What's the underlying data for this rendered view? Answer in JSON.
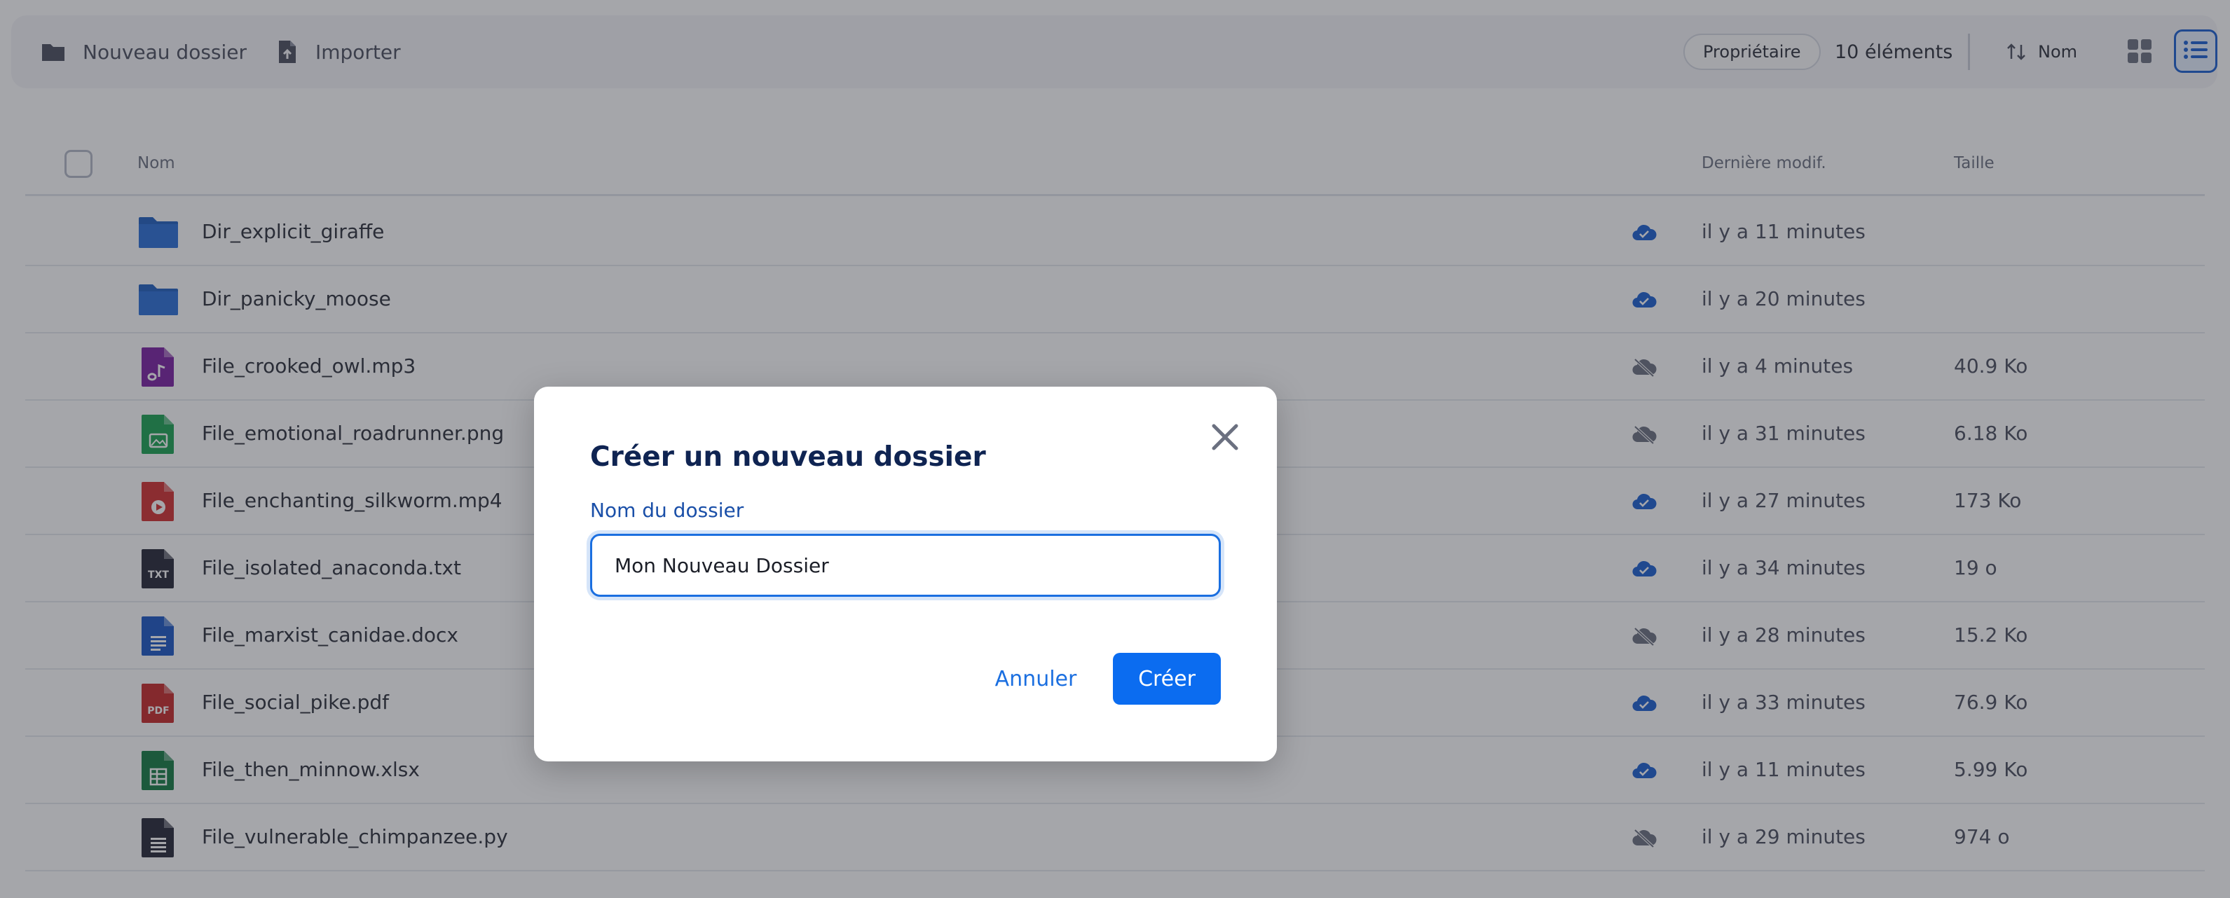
{
  "toolbar": {
    "new_folder_label": "Nouveau dossier",
    "import_label": "Importer",
    "owner_filter_label": "Propriétaire",
    "item_count": "10 éléments",
    "sort_label": "Nom"
  },
  "table": {
    "headers": {
      "name": "Nom",
      "modified": "Dernière modif.",
      "size": "Taille"
    },
    "rows": [
      {
        "name": "Dir_explicit_giraffe",
        "type": "folder",
        "synced": true,
        "modified": "il y a 11 minutes",
        "size": ""
      },
      {
        "name": "Dir_panicky_moose",
        "type": "folder",
        "synced": true,
        "modified": "il y a 20 minutes",
        "size": ""
      },
      {
        "name": "File_crooked_owl.mp3",
        "type": "audio",
        "synced": false,
        "modified": "il y a 4 minutes",
        "size": "40.9 Ko"
      },
      {
        "name": "File_emotional_roadrunner.png",
        "type": "image",
        "synced": false,
        "modified": "il y a 31 minutes",
        "size": "6.18 Ko"
      },
      {
        "name": "File_enchanting_silkworm.mp4",
        "type": "video",
        "synced": true,
        "modified": "il y a 27 minutes",
        "size": "173 Ko"
      },
      {
        "name": "File_isolated_anaconda.txt",
        "type": "text",
        "synced": true,
        "modified": "il y a 34 minutes",
        "size": "19 o"
      },
      {
        "name": "File_marxist_canidae.docx",
        "type": "doc",
        "synced": false,
        "modified": "il y a 28 minutes",
        "size": "15.2 Ko"
      },
      {
        "name": "File_social_pike.pdf",
        "type": "pdf",
        "synced": true,
        "modified": "il y a 33 minutes",
        "size": "76.9 Ko"
      },
      {
        "name": "File_then_minnow.xlsx",
        "type": "sheet",
        "synced": true,
        "modified": "il y a 11 minutes",
        "size": "5.99 Ko"
      },
      {
        "name": "File_vulnerable_chimpanzee.py",
        "type": "code",
        "synced": false,
        "modified": "il y a 29 minutes",
        "size": "974 o"
      }
    ],
    "icon_text": {
      "txt": "TXT",
      "pdf": "PDF"
    }
  },
  "dialog": {
    "title": "Créer un nouveau dossier",
    "field_label": "Nom du dossier",
    "field_value": "Mon Nouveau Dossier",
    "cancel_label": "Annuler",
    "create_label": "Créer"
  },
  "colors": {
    "accent": "#0b6cf0",
    "folder": "#1f5fbf",
    "audio": "#7b1fa2",
    "image": "#1aa251",
    "video": "#d32f2f",
    "text": "#252736",
    "doc": "#1a56c4",
    "pdf": "#c62828",
    "sheet": "#137a43",
    "code": "#252736",
    "synced": "#1b5fd1",
    "not_synced": "#6b7080"
  }
}
